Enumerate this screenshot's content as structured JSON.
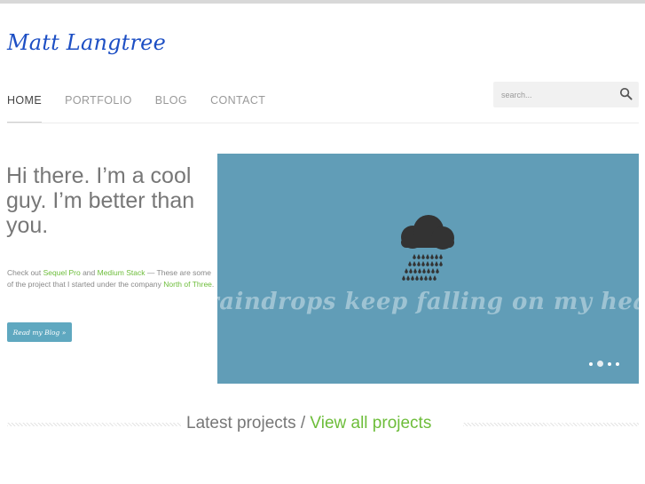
{
  "site": {
    "logo": "Matt Langtree"
  },
  "nav": {
    "items": [
      {
        "label": "HOME",
        "active": true
      },
      {
        "label": "PORTFOLIO"
      },
      {
        "label": "BLOG"
      },
      {
        "label": "CONTACT"
      }
    ]
  },
  "search": {
    "placeholder": "search...",
    "icon": "search-icon"
  },
  "hero": {
    "title": "Hi there. I’m a cool guy. I’m better than you.",
    "text_prefix": "Check out ",
    "link1": "Sequel Pro",
    "text_and": " and ",
    "link2": "Medium Stack",
    "text_middle": " — These are some of the project that I started under the company ",
    "link3": "North of Three",
    "text_suffix": ".",
    "button": "Read my Blog »"
  },
  "slider": {
    "caption": "raindrops keep falling on my head.",
    "icon": "rain-cloud-icon",
    "slide_count": 4,
    "active_slide": 2,
    "colors": {
      "background": "#619db7",
      "cloud": "#333333",
      "caption": "#9ec3d3"
    }
  },
  "projects": {
    "title": "Latest projects / ",
    "link": "View all projects"
  },
  "colors": {
    "accent_green": "#6dbd3a",
    "logo_blue": "#1d4fc4",
    "button_blue": "#5fa8c0"
  }
}
